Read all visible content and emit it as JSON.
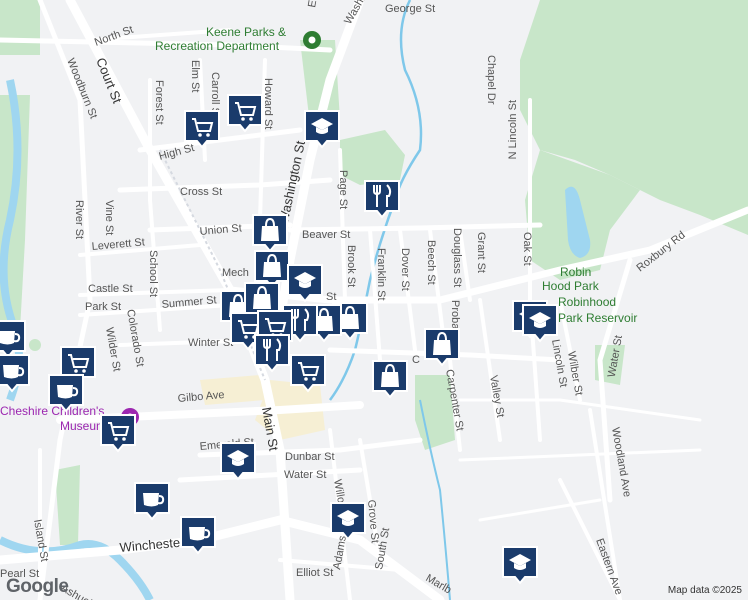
{
  "streets": {
    "north": "North St",
    "washington_top": "Washington St",
    "george": "George St",
    "woodburn": "Woodburn St",
    "court": "Court St",
    "forest": "Forest St",
    "elm": "Elm St",
    "carroll": "Carroll St",
    "howard": "Howard St",
    "chapel": "Chapel Dr",
    "n_lincoln": "N Lincoln St",
    "high": "High St",
    "washington": "Washington St",
    "cross": "Cross St",
    "page": "Page St",
    "river": "River St",
    "vine": "Vine St",
    "union": "Union St",
    "beaver": "Beaver St",
    "brook": "Brook St",
    "franklin": "Franklin St",
    "dover": "Dover St",
    "beech": "Beech St",
    "douglass": "Douglass St",
    "grant": "Grant St",
    "oak": "Oak St",
    "leverett": "Leverett St",
    "school": "School St",
    "castle": "Castle St",
    "mech": "Mech",
    "summer": "Summer St",
    "st": "St",
    "probate": "Probate St",
    "roxbury": "Roxbury Rd",
    "park": "Park St",
    "colorado": "Colorado St",
    "wilder": "Wilder St",
    "winter": "Winter St",
    "lincoln": "Lincoln St",
    "wilber": "Wilber St",
    "water_right": "Water St",
    "valley": "Valley St",
    "carpenter": "Carpenter St",
    "c": "C",
    "gilbo": "Gilbo Ave",
    "main": "Main St",
    "emerald": "Emerald St",
    "dunbar": "Dunbar St",
    "water": "Water St",
    "woodland": "Woodland Ave",
    "island": "Island St",
    "winchester": "Winchester St",
    "adams": "Adams St",
    "grove": "Grove St",
    "willow": "Willow St",
    "south": "South St",
    "eastern": "Eastern Ave",
    "elliot": "Elliot St",
    "marlb": "Marlb",
    "pearl": "Pearl St",
    "ashuelot": "Ashuelot",
    "e": "E"
  },
  "places": {
    "keene_parks_line1": "Keene Parks &",
    "keene_parks_line2": "Recreation Department",
    "robin_hood_line1": "Robin",
    "robin_hood_line2": "Hood Park",
    "reservoir_line1": "Robinhood",
    "reservoir_line2": "Park Reservoir",
    "museum_line1": "Cheshire Children's",
    "museum_line2": "Museum"
  },
  "attribution": "Map data ©2025",
  "logo": "Google",
  "colors": {
    "background": "#f1f2f4",
    "park": "#c8e6c9",
    "water": "#9fd6f0",
    "road": "#ffffff",
    "marker": "#1a3b6b",
    "marker_border": "#ffffff"
  },
  "markers": [
    {
      "type": "cart",
      "icon": "shopping-cart-icon"
    },
    {
      "type": "cart",
      "icon": "shopping-cart-icon"
    },
    {
      "type": "school",
      "icon": "graduation-cap-icon"
    },
    {
      "type": "restaurant",
      "icon": "fork-knife-icon"
    },
    {
      "type": "bag",
      "icon": "shopping-bag-icon"
    },
    {
      "type": "bag",
      "icon": "shopping-bag-icon"
    },
    {
      "type": "school",
      "icon": "graduation-cap-icon"
    },
    {
      "type": "bag",
      "icon": "shopping-bag-icon"
    },
    {
      "type": "bag",
      "icon": "shopping-bag-icon"
    },
    {
      "type": "bag",
      "icon": "shopping-bag-icon"
    },
    {
      "type": "bag",
      "icon": "shopping-bag-icon"
    },
    {
      "type": "restaurant",
      "icon": "fork-knife-icon"
    },
    {
      "type": "cart",
      "icon": "shopping-cart-icon"
    },
    {
      "type": "cart",
      "icon": "shopping-cart-icon"
    },
    {
      "type": "restaurant",
      "icon": "fork-knife-icon"
    },
    {
      "type": "cart",
      "icon": "shopping-cart-icon"
    },
    {
      "type": "bag",
      "icon": "shopping-bag-icon"
    },
    {
      "type": "bag",
      "icon": "shopping-bag-icon"
    },
    {
      "type": "school",
      "icon": "graduation-cap-icon"
    },
    {
      "type": "school",
      "icon": "graduation-cap-icon"
    },
    {
      "type": "coffee",
      "icon": "coffee-cup-icon"
    },
    {
      "type": "cart",
      "icon": "shopping-cart-icon"
    },
    {
      "type": "coffee",
      "icon": "coffee-cup-icon"
    },
    {
      "type": "coffee",
      "icon": "coffee-cup-icon"
    },
    {
      "type": "cart",
      "icon": "shopping-cart-icon"
    },
    {
      "type": "school",
      "icon": "graduation-cap-icon"
    },
    {
      "type": "coffee",
      "icon": "coffee-cup-icon"
    },
    {
      "type": "coffee",
      "icon": "coffee-cup-icon"
    },
    {
      "type": "school",
      "icon": "graduation-cap-icon"
    },
    {
      "type": "school",
      "icon": "graduation-cap-icon"
    }
  ]
}
